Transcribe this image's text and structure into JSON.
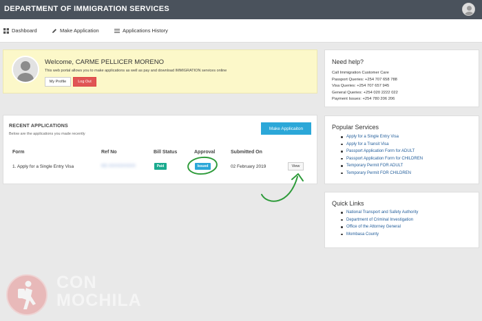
{
  "header": {
    "brand": "DEPARTMENT OF IMMIGRATION SERVICES",
    "avatar_icon": "user-avatar-icon"
  },
  "nav": {
    "items": [
      {
        "label": "Dashboard",
        "icon": "dashboard-grid-icon"
      },
      {
        "label": "Make Application",
        "icon": "pencil-icon"
      },
      {
        "label": "Applications History",
        "icon": "list-icon"
      }
    ]
  },
  "welcome": {
    "title": "Welcome, CARME PELLICER MORENO",
    "text": "This web portal allows you to make applications as well as pay and download IMMIGRATION services online",
    "profile_button": "My Profile",
    "logout_button": "Log Out",
    "colors": {
      "background": "#fcf8c9",
      "logout": "#e05555"
    }
  },
  "help": {
    "title": "Need help?",
    "lines": [
      "Call Immigration Customer Care",
      "Passport Queries: +254 707 658 788",
      "Visa Queries: +254 707 657 945",
      "General Queries: +254 020 2222 022",
      "Payment Issues: +254 780 206 206"
    ]
  },
  "recent": {
    "title": "RECENT APPLICATIONS",
    "subtitle": "Below are the applications you made recently",
    "make_button": "Make Applicaiton",
    "columns": [
      "Form",
      "Ref No",
      "Bill Status",
      "Approval",
      "Submitted On"
    ],
    "rows": [
      {
        "form": "1. Apply for a Single Entry Visa",
        "ref_no": "KE-XXXXXXXXX",
        "bill_status": "Paid",
        "approval": "Issued",
        "submitted_on": "02 February 2019",
        "action": "View"
      }
    ],
    "colors": {
      "accent": "#2ba7d8",
      "paid": "#1aaa8e",
      "annotation": "#2e9b3a"
    }
  },
  "popular": {
    "title": "Popular Services",
    "items": [
      "Apply for a Single Entry Visa",
      "Apply for a Transit Visa",
      "Passport Application Form for ADULT",
      "Passport Application Form for CHILDREN",
      "Temporary Permit FOR ADULT",
      "Temporary Permit FOR CHILDREN"
    ]
  },
  "quick_links": {
    "title": "Quick Links",
    "items": [
      "National Transport and Safety Authority",
      "Department of Criminal Investigation",
      "Office of the Attorney General",
      "Mombasa County"
    ]
  },
  "watermark": {
    "line1": "CON",
    "line2": "MOCHILA",
    "logo_icon": "hiker-logo-icon"
  }
}
